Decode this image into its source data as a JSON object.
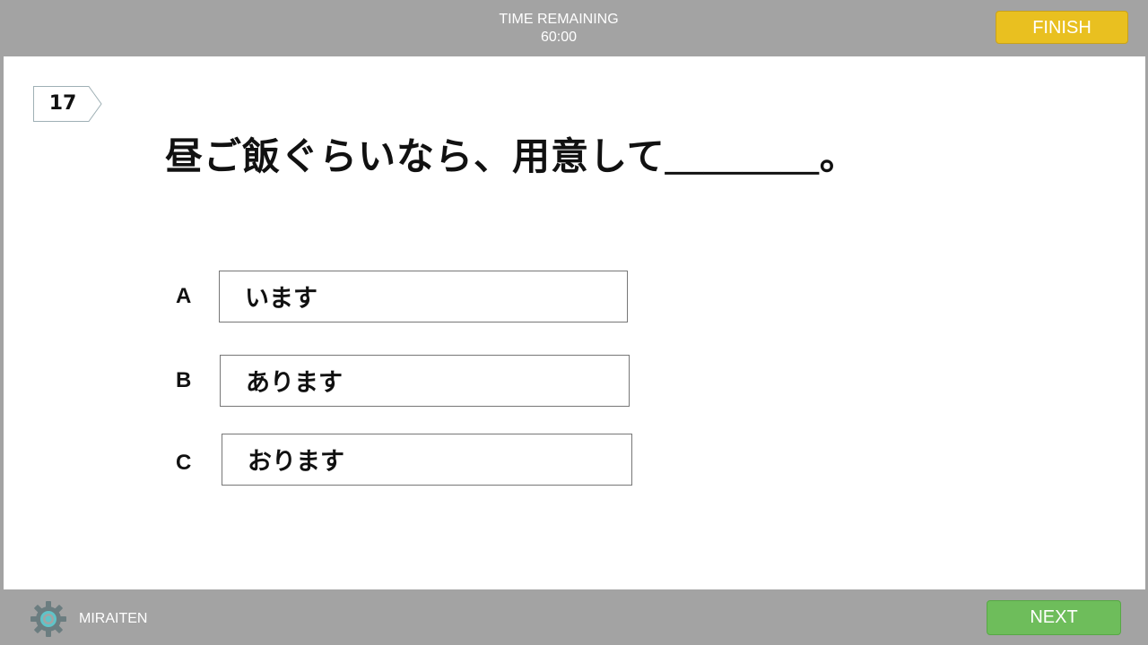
{
  "header": {
    "timer_label": "TIME REMAINING",
    "timer_value": "60:00",
    "finish_label": "FINISH"
  },
  "question": {
    "number": "17",
    "text": "昼ご飯ぐらいなら、用意して＿＿＿＿。"
  },
  "options": [
    {
      "letter": "A",
      "text": "います"
    },
    {
      "letter": "B",
      "text": "あります"
    },
    {
      "letter": "C",
      "text": "おります"
    }
  ],
  "footer": {
    "brand": "MIRAITEN",
    "next_label": "NEXT",
    "brand_icon": "gear-icon"
  },
  "colors": {
    "bar": "#a3a3a3",
    "finish": "#e9c020",
    "next": "#6ebd5b",
    "brand_icon": "#5fc4c8"
  }
}
